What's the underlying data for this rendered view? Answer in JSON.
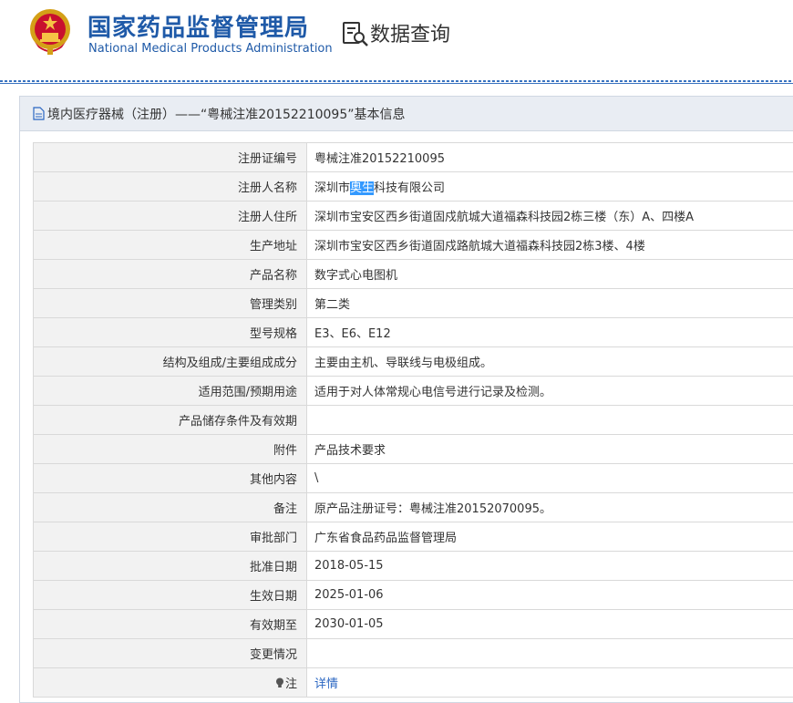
{
  "header": {
    "org_name_cn": "国家药品监督管理局",
    "org_name_en": "National Medical Products Administration",
    "section_title": "数据查询"
  },
  "panel": {
    "title": "境内医疗器械（注册）——“粤械注准20152210095”基本信息"
  },
  "rows": [
    {
      "label": "注册证编号",
      "value": "粤械注准20152210095"
    },
    {
      "label": "注册人名称",
      "value_pre": "深圳市",
      "value_hl": "奥生",
      "value_post": "科技有限公司"
    },
    {
      "label": "注册人住所",
      "value": "深圳市宝安区西乡街道固戍航城大道福森科技园2栋三楼（东）A、四楼A"
    },
    {
      "label": "生产地址",
      "value": "深圳市宝安区西乡街道固戍路航城大道福森科技园2栋3楼、4楼"
    },
    {
      "label": "产品名称",
      "value": "数字式心电图机"
    },
    {
      "label": "管理类别",
      "value": "第二类"
    },
    {
      "label": "型号规格",
      "value": "E3、E6、E12"
    },
    {
      "label": "结构及组成/主要组成成分",
      "value": "主要由主机、导联线与电极组成。"
    },
    {
      "label": "适用范围/预期用途",
      "value": "适用于对人体常规心电信号进行记录及检测。"
    },
    {
      "label": "产品储存条件及有效期",
      "value": ""
    },
    {
      "label": "附件",
      "value": "产品技术要求"
    },
    {
      "label": "其他内容",
      "value": "\\"
    },
    {
      "label": "备注",
      "value": "原产品注册证号：粤械注准20152070095。"
    },
    {
      "label": "审批部门",
      "value": "广东省食品药品监督管理局"
    },
    {
      "label": "批准日期",
      "value": "2018-05-15"
    },
    {
      "label": "生效日期",
      "value": "2025-01-06"
    },
    {
      "label": "有效期至",
      "value": "2030-01-05"
    },
    {
      "label": "变更情况",
      "value": ""
    },
    {
      "label": "注",
      "value": "详情"
    }
  ],
  "colors": {
    "brand_blue": "#1f5aa8",
    "highlight": "#3399ff",
    "link": "#2a66c2"
  },
  "icons": [
    "national-emblem-icon",
    "data-query-icon",
    "document-icon",
    "note-bulb-icon"
  ]
}
